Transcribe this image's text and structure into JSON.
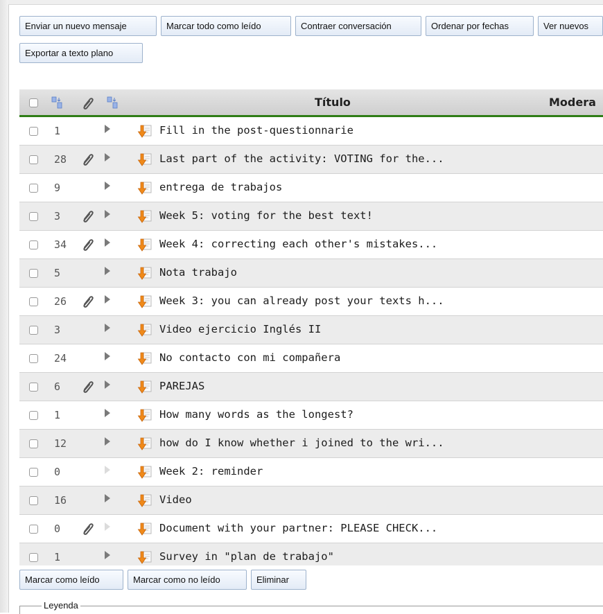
{
  "toolbar": {
    "new_message": "Enviar un nuevo mensaje",
    "mark_all_read": "Marcar todo como leído",
    "collapse_conversation": "Contraer conversación",
    "sort_by_date": "Ordenar por fechas",
    "view_new": "Ver nuevos",
    "export_plain_text": "Exportar a texto plano"
  },
  "table": {
    "columns": {
      "title": "Título",
      "moderation": "Modera"
    },
    "rows": [
      {
        "count": "1",
        "attachment": false,
        "expand_active": true,
        "title": "Fill in the post-questionnarie"
      },
      {
        "count": "28",
        "attachment": true,
        "expand_active": true,
        "title": "Last part of the activity: VOTING for the..."
      },
      {
        "count": "9",
        "attachment": false,
        "expand_active": true,
        "title": "entrega de trabajos"
      },
      {
        "count": "3",
        "attachment": true,
        "expand_active": true,
        "title": "Week 5: voting for the best text!"
      },
      {
        "count": "34",
        "attachment": true,
        "expand_active": true,
        "title": "Week 4: correcting each other's mistakes..."
      },
      {
        "count": "5",
        "attachment": false,
        "expand_active": true,
        "title": "Nota trabajo"
      },
      {
        "count": "26",
        "attachment": true,
        "expand_active": true,
        "title": "Week 3: you can already post your texts h..."
      },
      {
        "count": "3",
        "attachment": false,
        "expand_active": true,
        "title": "Video ejercicio Inglés II"
      },
      {
        "count": "24",
        "attachment": false,
        "expand_active": true,
        "title": "No contacto con mi compañera"
      },
      {
        "count": "6",
        "attachment": true,
        "expand_active": true,
        "title": "PAREJAS"
      },
      {
        "count": "1",
        "attachment": false,
        "expand_active": true,
        "title": "How many words as the longest?"
      },
      {
        "count": "12",
        "attachment": false,
        "expand_active": true,
        "title": "how do I know whether i joined to the wri..."
      },
      {
        "count": "0",
        "attachment": false,
        "expand_active": false,
        "title": "Week 2: reminder"
      },
      {
        "count": "16",
        "attachment": false,
        "expand_active": true,
        "title": "Video"
      },
      {
        "count": "0",
        "attachment": true,
        "expand_active": false,
        "title": "Document with your partner: PLEASE CHECK..."
      },
      {
        "count": "1",
        "attachment": false,
        "expand_active": true,
        "title": "Survey in \"plan de trabajo\""
      }
    ]
  },
  "bottom_actions": {
    "mark_read": "Marcar como leído",
    "mark_unread": "Marcar como no leído",
    "delete": "Eliminar"
  },
  "legend": {
    "label": "Leyenda"
  },
  "colors": {
    "header_underline": "#2e7d16",
    "button_border": "#9db2cc",
    "row_alt": "#ececec"
  }
}
